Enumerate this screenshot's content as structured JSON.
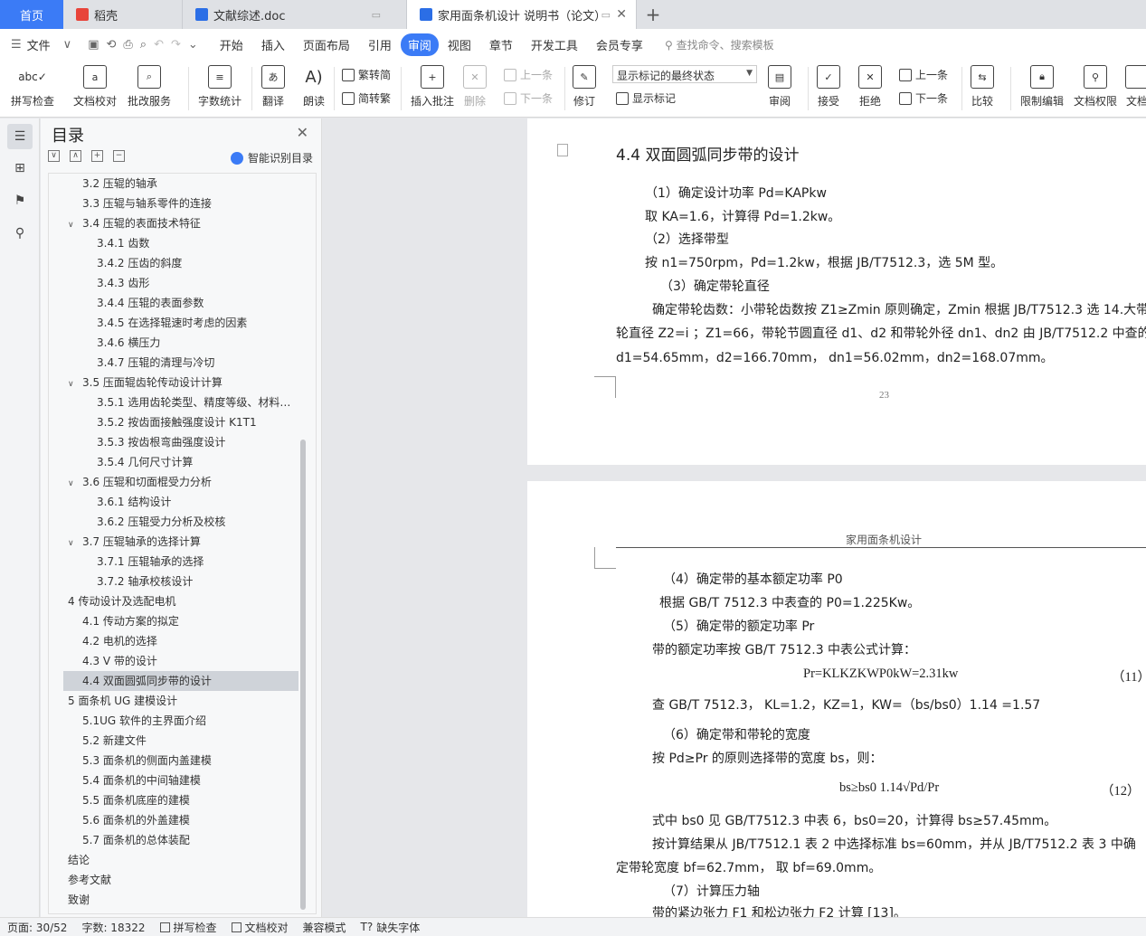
{
  "tabs": {
    "home": "首页",
    "daoke": "稻壳",
    "doc1": "文献综述.doc",
    "doc2": "家用面条机设计 说明书（论文）"
  },
  "menu": {
    "file": "文件",
    "items": [
      "开始",
      "插入",
      "页面布局",
      "引用",
      "审阅",
      "视图",
      "章节",
      "开发工具",
      "会员专享"
    ],
    "search": "查找命令、搜索模板"
  },
  "ribbon": {
    "spell": "拼写检查",
    "proof": "文档校对",
    "annot_service": "批改服务",
    "wordcount": "字数统计",
    "translate": "翻译",
    "read": "朗读",
    "trad": "繁转简",
    "simp": "简转繁",
    "insert_comment": "插入批注",
    "delete": "删除",
    "prev": "上一条",
    "next": "下一条",
    "track": "修订",
    "markup_state": "显示标记的最终状态",
    "show_markup": "显示标记",
    "review": "审阅",
    "accept": "接受",
    "reject": "拒绝",
    "prev2": "上一条",
    "next2": "下一条",
    "compare": "比较",
    "restrict": "限制编辑",
    "perm": "文档权限",
    "more": "文档"
  },
  "nav": {
    "title": "目录",
    "ai": "智能识别目录",
    "items": [
      {
        "text": "3.2 压辊的轴承",
        "level": 2
      },
      {
        "text": "3.3 压辊与轴系零件的连接",
        "level": 2
      },
      {
        "text": "3.4 压辊的表面技术特征",
        "level": 2,
        "arrow": "∨"
      },
      {
        "text": "3.4.1 齿数",
        "level": 3
      },
      {
        "text": "3.4.2 压齿的斜度",
        "level": 3
      },
      {
        "text": "3.4.3 齿形",
        "level": 3
      },
      {
        "text": "3.4.4 压辊的表面参数",
        "level": 3
      },
      {
        "text": "3.4.5 在选择辊速时考虑的因素",
        "level": 3
      },
      {
        "text": "3.4.6 横压力",
        "level": 3
      },
      {
        "text": "3.4.7 压辊的清理与冷切",
        "level": 3
      },
      {
        "text": "3.5 压面辊齿轮传动设计计算",
        "level": 2,
        "arrow": "∨"
      },
      {
        "text": "3.5.1 选用齿轮类型、精度等级、材料…",
        "level": 3
      },
      {
        "text": "3.5.2 按齿面接触强度设计 K1T1",
        "level": 3
      },
      {
        "text": "3.5.3 按齿根弯曲强度设计",
        "level": 3
      },
      {
        "text": "3.5.4 几何尺寸计算",
        "level": 3
      },
      {
        "text": "3.6 压辊和切面棍受力分析",
        "level": 2,
        "arrow": "∨"
      },
      {
        "text": "3.6.1 结构设计",
        "level": 3
      },
      {
        "text": "3.6.2 压辊受力分析及校核",
        "level": 3
      },
      {
        "text": "3.7 压辊轴承的选择计算",
        "level": 2,
        "arrow": "∨"
      },
      {
        "text": "3.7.1 压辊轴承的选择",
        "level": 3
      },
      {
        "text": "3.7.2 轴承校核设计",
        "level": 3
      },
      {
        "text": "4 传动设计及选配电机",
        "level": 1,
        "arrow": "∨"
      },
      {
        "text": "4.1 传动方案的拟定",
        "level": 2
      },
      {
        "text": "4.2 电机的选择",
        "level": 2
      },
      {
        "text": "4.3 V 带的设计",
        "level": 2
      },
      {
        "text": "4.4 双面圆弧同步带的设计",
        "level": 2,
        "selected": true
      },
      {
        "text": "5  面条机 UG 建模设计",
        "level": 1,
        "arrow": "∨"
      },
      {
        "text": "5.1UG 软件的主界面介绍",
        "level": 2
      },
      {
        "text": "5.2 新建文件",
        "level": 2
      },
      {
        "text": "5.3 面条机的侧面内盖建模",
        "level": 2
      },
      {
        "text": "5.4 面条机的中间轴建模",
        "level": 2
      },
      {
        "text": "5.5 面条机底座的建模",
        "level": 2
      },
      {
        "text": "5.6 面条机的外盖建模",
        "level": 2
      },
      {
        "text": "5.7 面条机的总体装配",
        "level": 2
      },
      {
        "text": "结论",
        "level": 1
      },
      {
        "text": "参考文献",
        "level": 1
      },
      {
        "text": "致谢",
        "level": 1
      }
    ]
  },
  "page1": {
    "heading": "4.4 双面圆弧同步带的设计",
    "lines": [
      "（1）确定设计功率 Pd=KAPkw",
      "取 KA=1.6，计算得 Pd=1.2kw。",
      "（2）选择带型",
      "按 n1=750rpm，Pd=1.2kw，根据 JB/T7512.3，选 5M 型。",
      "（3）确定带轮直径",
      "确定带轮齿数：小带轮齿数按 Z1≥Zmin 原则确定，Zmin 根据 JB/T7512.3 选 14.大带",
      "轮直径 Z2=i ；Z1=66，带轮节圆直径 d1、d2 和带轮外径 dn1、dn2 由 JB/T7512.2 中查的",
      "d1=54.65mm，d2=166.70mm，  dn1=56.02mm，dn2=168.07mm。"
    ],
    "page_number": "23"
  },
  "page2": {
    "header": "家用面条机设计",
    "lines": [
      "（4）确定带的基本额定功率 P0",
      "根据 GB/T 7512.3 中表查的 P0=1.225Kw。",
      "（5）确定带的额定功率 Pr",
      "带的额定功率按 GB/T 7512.3 中表公式计算：",
      "Pr=KLKZKWP0kW=2.31kw",
      "（11）",
      "查 GB/T 7512.3，  KL=1.2，KZ=1，KW=（bs/bs0）1.14 =1.57",
      "（6）确定带和带轮的宽度",
      "按 Pd≥Pr 的原则选择带的宽度 bs，则：",
      "bs≥bs0 1.14√Pd/Pr",
      "（12）",
      "式中 bs0 见 GB/T7512.3 中表 6，bs0=20，计算得 bs≥57.45mm。",
      "按计算结果从 JB/T7512.1 表 2 中选择标准 bs=60mm，并从 JB/T7512.2 表 3 中确",
      "定带轮宽度 bf=62.7mm，  取 bf=69.0mm。",
      "（7）计算压力轴",
      "带的紧边张力 F1 和松边张力 F2 计算 [13]。"
    ]
  },
  "status": {
    "page": "页面: 30/52",
    "words": "字数: 18322",
    "spell": "拼写检查",
    "proof": "文档校对",
    "compat": "兼容模式",
    "missing_font": "缺失字体"
  }
}
